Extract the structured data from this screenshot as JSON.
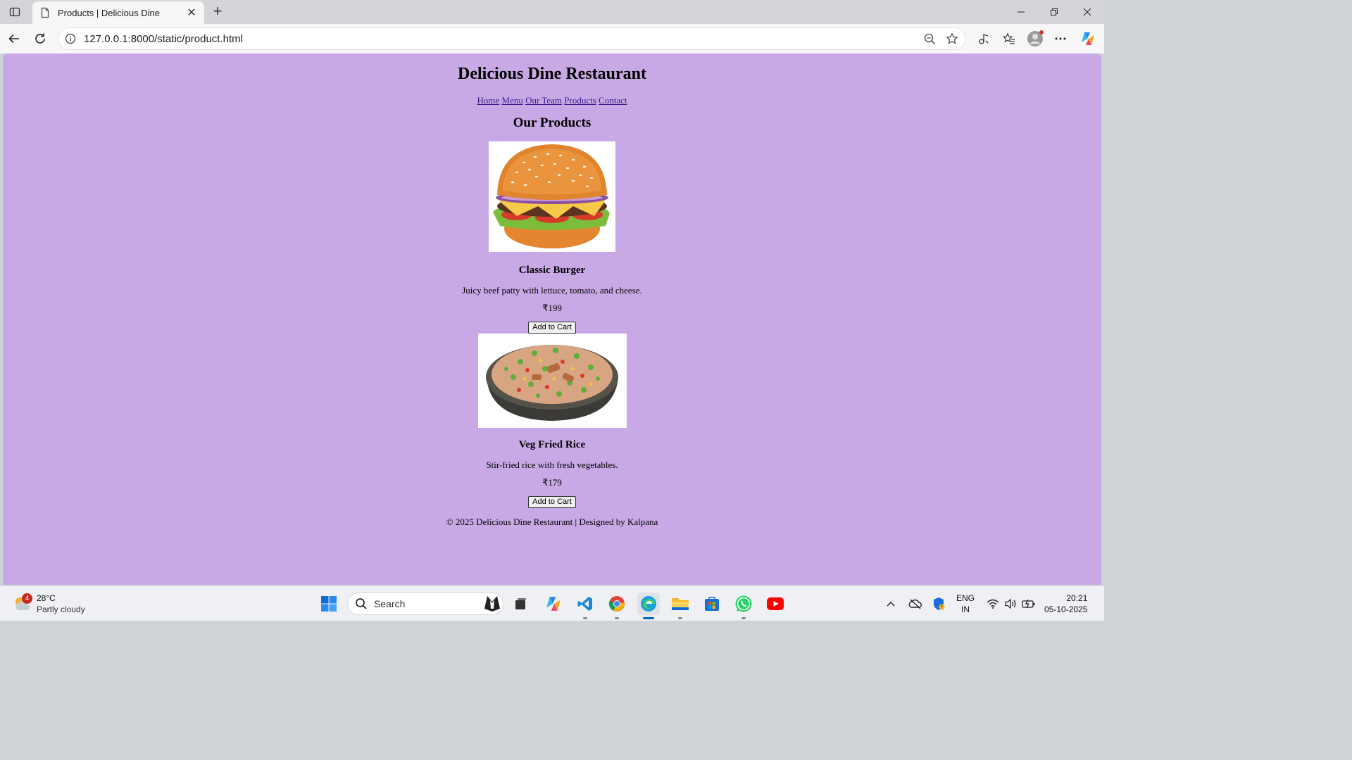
{
  "browser": {
    "tab_title": "Products | Delicious Dine",
    "url": "127.0.0.1:8000/static/product.html"
  },
  "page": {
    "title": "Delicious Dine Restaurant",
    "nav": [
      "Home",
      "Menu",
      "Our Team",
      "Products",
      "Contact"
    ],
    "section_title": "Our Products",
    "products": [
      {
        "name": "Classic Burger",
        "description": "Juicy beef patty with lettuce, tomato, and cheese.",
        "price": "₹199",
        "button": "Add to Cart"
      },
      {
        "name": "Veg Fried Rice",
        "description": "Stir-fried rice with fresh vegetables.",
        "price": "₹179",
        "button": "Add to Cart"
      }
    ],
    "footer": "© 2025 Delicious Dine Restaurant | Designed by Kalpana"
  },
  "taskbar": {
    "weather_badge": "4",
    "temperature": "28°C",
    "condition": "Partly cloudy",
    "search_label": "Search",
    "language": "ENG",
    "region": "IN",
    "time": "20:21",
    "date": "05-10-2025"
  },
  "colors": {
    "page_background": "#c8a9e6",
    "link": "#3b1e8c"
  }
}
